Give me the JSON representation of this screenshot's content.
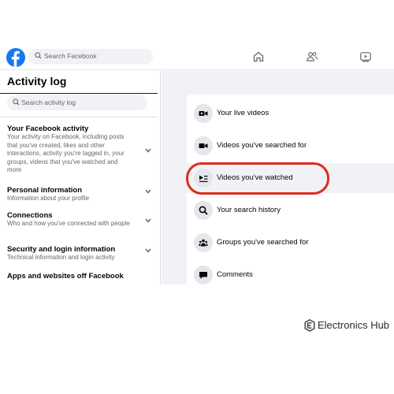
{
  "topbar": {
    "search_placeholder": "Search Facebook",
    "nav_icons": [
      "home-icon",
      "friends-icon",
      "watch-icon"
    ]
  },
  "sidebar": {
    "title": "Activity log",
    "search_placeholder": "Search activity log",
    "categories": [
      {
        "title": "Your Facebook activity",
        "description": "Your activity on Facebook, including posts that you've created, likes and other interactions, activity you're tagged in, your groups, videos that you've watched and more"
      },
      {
        "title": "Personal information",
        "description": "Information about your profile"
      },
      {
        "title": "Connections",
        "description": "Who and how you've connected with people"
      },
      {
        "title": "Security and login information",
        "description": "Technical information and login activity"
      },
      {
        "title": "Apps and websites off Facebook",
        "description": ""
      }
    ]
  },
  "main": {
    "items": [
      {
        "label": "Your live videos",
        "icon": "live-video-icon"
      },
      {
        "label": "Videos you've searched for",
        "icon": "video-camera-icon"
      },
      {
        "label": "Videos you've watched",
        "icon": "watched-video-icon"
      },
      {
        "label": "Your search history",
        "icon": "search-icon"
      },
      {
        "label": "Groups you've searched for",
        "icon": "groups-icon"
      },
      {
        "label": "Comments",
        "icon": "comment-icon"
      }
    ],
    "highlighted_item": "Videos you've watched",
    "highlight_color": "#e02a1f"
  },
  "watermark": {
    "text": "Electronics Hub"
  },
  "colors": {
    "brand": "#1877f2",
    "background": "#f0f2f5",
    "highlight": "#e02a1f"
  }
}
